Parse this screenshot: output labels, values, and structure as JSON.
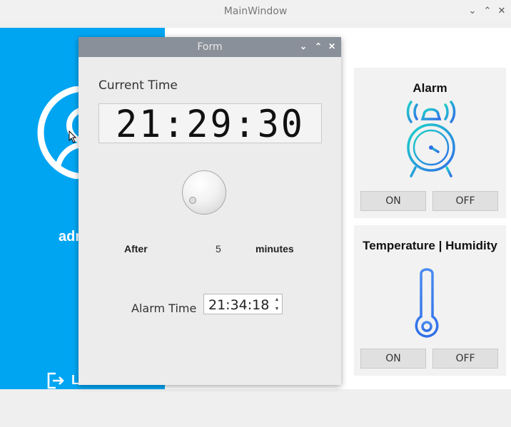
{
  "main_window": {
    "title": "MainWindow",
    "user_label": "adr",
    "logout_label": "L"
  },
  "alarm_card": {
    "title": "Alarm",
    "on_label": "ON",
    "off_label": "OFF"
  },
  "temp_card": {
    "title": "Temperature | Humidity",
    "on_label": "ON",
    "off_label": "OFF"
  },
  "form": {
    "title": "Form",
    "current_time_label": "Current Time",
    "current_time": "21:29:30",
    "after_label": "After",
    "minutes_value": "5",
    "minutes_label": "minutes",
    "alarm_time_label": "Alarm Time",
    "alarm_time": "21:34:18"
  },
  "colors": {
    "accent": "#00a5f2",
    "icon_gradient_start": "#1dd3c8",
    "icon_gradient_end": "#2f6fe8"
  }
}
